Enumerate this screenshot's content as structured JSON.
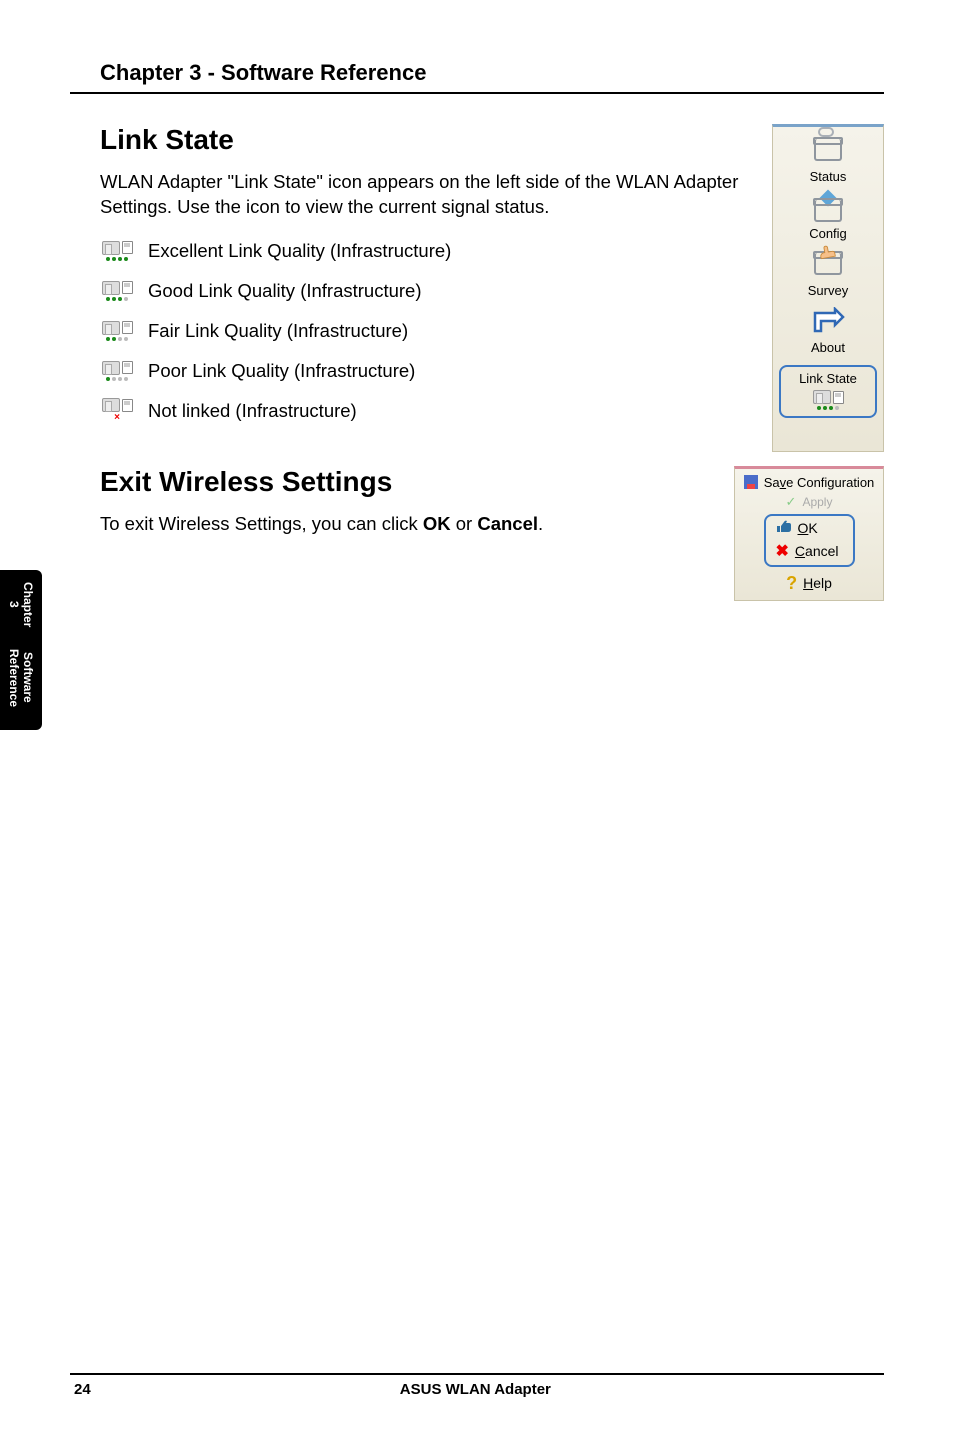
{
  "header": {
    "title": "Chapter 3 - Software Reference"
  },
  "linkState": {
    "heading": "Link State",
    "body": "WLAN Adapter \"Link State\" icon appears on the left side of the WLAN Adapter Settings. Use the icon to view the current signal status.",
    "rows": [
      {
        "label": "Excellent Link Quality (Infrastructure)"
      },
      {
        "label": "Good Link Quality (Infrastructure)"
      },
      {
        "label": "Fair Link Quality (Infrastructure)"
      },
      {
        "label": "Poor Link Quality (Infrastructure)"
      },
      {
        "label": "Not linked (Infrastructure)"
      }
    ]
  },
  "sidePanel": {
    "items": [
      {
        "label": "Status"
      },
      {
        "label": "Config"
      },
      {
        "label": "Survey"
      },
      {
        "label": "About"
      }
    ],
    "linkStateBox": "Link State"
  },
  "exit": {
    "heading": "Exit Wireless Settings",
    "body_pre": "To exit Wireless Settings, you can click ",
    "ok": "OK",
    "body_mid": " or ",
    "cancel": "Cancel",
    "body_post": "."
  },
  "cfgPanel": {
    "save_pre": "Sa",
    "save_u": "v",
    "save_post": "e Configuration",
    "apply": "Apply",
    "ok_u": "O",
    "ok_post": "K",
    "cancel_u": "C",
    "cancel_post": "ancel",
    "help_u": "H",
    "help_post": "elp"
  },
  "sideTab": {
    "chapter": "Chapter 3",
    "sub": "Software Reference"
  },
  "footer": {
    "page": "24",
    "center": "ASUS WLAN Adapter"
  }
}
